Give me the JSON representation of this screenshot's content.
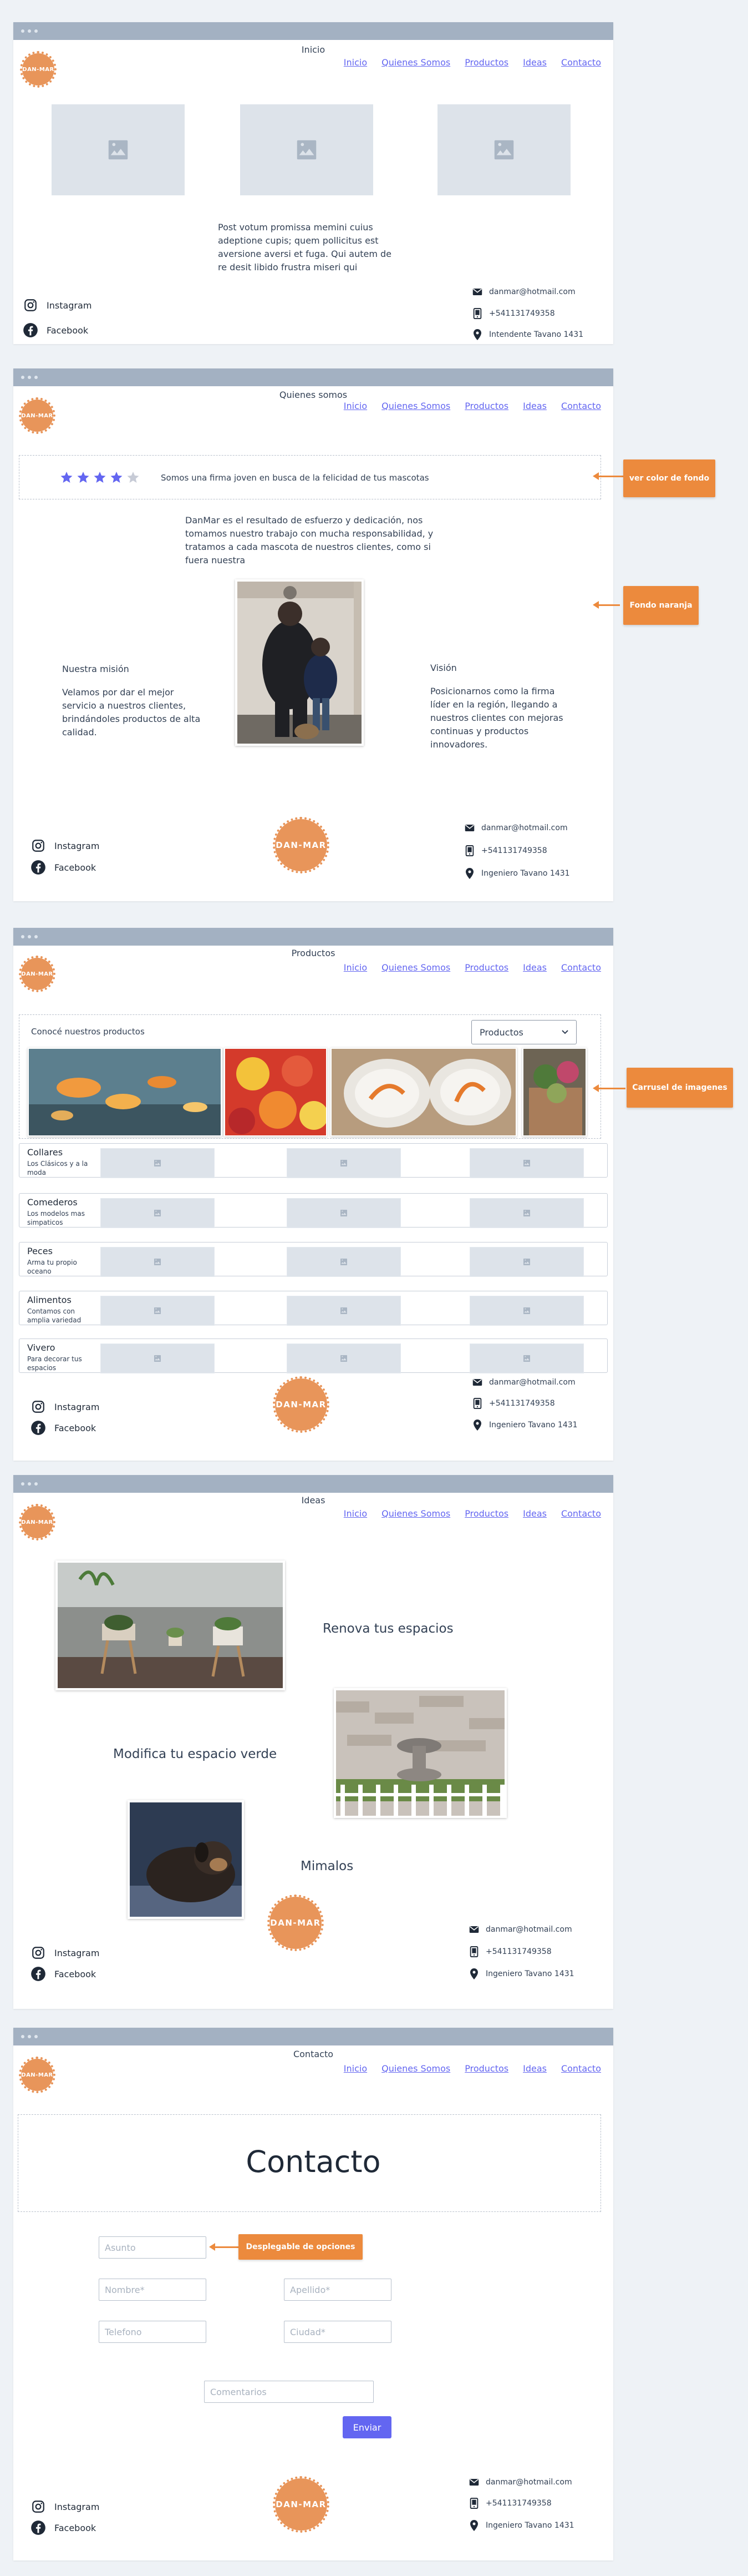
{
  "nav": {
    "inicio": "Inicio",
    "quienes": "Quienes Somos",
    "productos": "Productos",
    "ideas": "Ideas",
    "contacto": "Contacto"
  },
  "logo_text": "DAN-MAR",
  "footer": {
    "instagram": "Instagram",
    "facebook": "Facebook",
    "email": "danmar@hotmail.com",
    "phone": "+541131749358",
    "address_inicio": "Intendente Tavano 1431",
    "address": "Ingeniero Tavano 1431"
  },
  "icons": [
    "image-placeholder-icon",
    "instagram-icon",
    "facebook-icon",
    "mail-icon",
    "phone-icon",
    "location-pin-icon",
    "star-icon",
    "chevron-down-icon"
  ],
  "colors": {
    "accent": "#6366f1",
    "orange": "#e8955a",
    "annotation": "#ec8a3d",
    "frame_bar": "#a3b1c2"
  },
  "inicio": {
    "title": "Inicio",
    "body": "Post votum promissa memini cuius adeptione cupis; quem pollicitus est aversione aversi et fuga. Qui autem de re desit libido frustra miseri qui"
  },
  "quienes": {
    "title": "Quienes somos",
    "rating_stars": 4,
    "rating_max": 5,
    "tagline": "Somos una firma joven en busca de la felicidad de tus mascotas",
    "intro": "DanMar es el resultado de esfuerzo y dedicación, nos tomamos nuestro trabajo con mucha responsabilidad, y tratamos a cada mascota de nuestros clientes, como si fuera nuestra",
    "mission_title": "Nuestra misión",
    "mission_body": "Velamos por dar  el mejor servicio a nuestros clientes, brindándoles productos de alta calidad.",
    "vision_title": "Visión",
    "vision_body": "Posicionarnos como la firma líder en la región, llegando a nuestros clientes con mejoras continuas y productos innovadores.",
    "note_bg": "ver color de fondo",
    "note_orange": "Fondo naranja"
  },
  "productos": {
    "title": "Productos",
    "carousel_title": "Conocé nuestros productos",
    "select_value": "Productos",
    "note_carousel": "Carrusel de imagenes",
    "categories": [
      {
        "title": "Collares",
        "subtitle": "Los Clásicos y a la moda"
      },
      {
        "title": "Comederos",
        "subtitle": "Los modelos mas simpaticos"
      },
      {
        "title": "Peces",
        "subtitle": "Arma tu propio oceano"
      },
      {
        "title": "Alimentos",
        "subtitle": "Contamos con amplia variedad"
      },
      {
        "title": "Vivero",
        "subtitle": "Para decorar tus espacios"
      }
    ]
  },
  "ideas": {
    "title": "Ideas",
    "idea1": "Renova tus espacios",
    "idea2": "Modifica tu espacio verde",
    "idea3": "Mimalos"
  },
  "contacto": {
    "title": "Contacto",
    "heading": "Contacto",
    "asunto_placeholder": "Asunto",
    "nombre_placeholder": "Nombre*",
    "apellido_placeholder": "Apellido*",
    "telefono_placeholder": "Telefono",
    "ciudad_placeholder": "Ciudad*",
    "comentarios_placeholder": "Comentarios",
    "submit": "Enviar",
    "note_dropdown": "Desplegable de opciones"
  }
}
